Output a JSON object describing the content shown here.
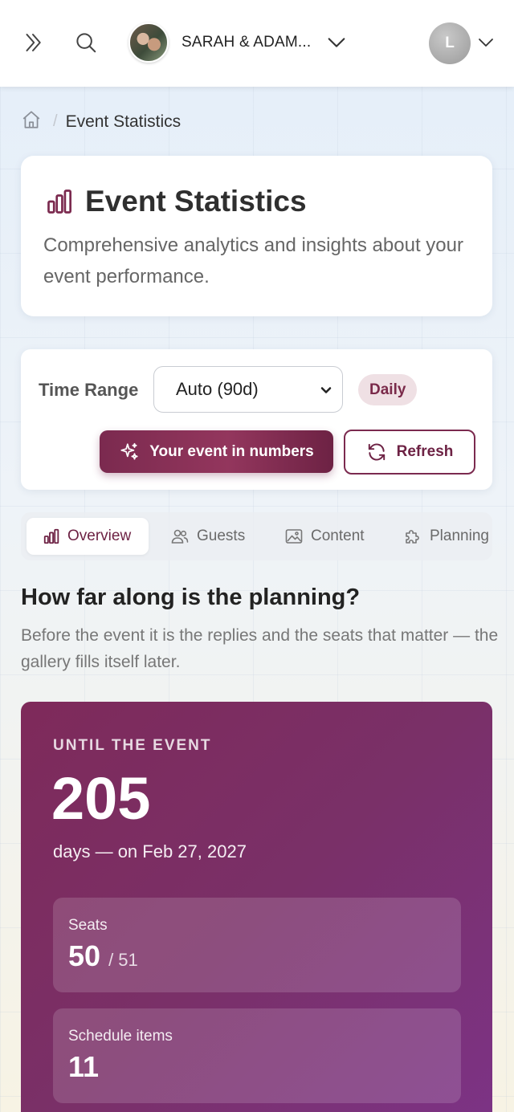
{
  "topbar": {
    "event_name": "SARAH & ADAM...",
    "user_initial": "L",
    "icons": [
      "chevrons-right-icon",
      "search-icon",
      "chevron-down-icon"
    ]
  },
  "breadcrumb": {
    "separator": "/",
    "current": "Event Statistics"
  },
  "header": {
    "title": "Event Statistics",
    "subtitle": "Comprehensive analytics and insights about your event performance."
  },
  "controls": {
    "time_range_label": "Time Range",
    "time_range_value": "Auto (90d)",
    "granularity_badge": "Daily",
    "numbers_button": "Your event in numbers",
    "refresh_button": "Refresh"
  },
  "tabs": [
    {
      "label": "Overview",
      "icon": "bar-chart-icon",
      "active": true
    },
    {
      "label": "Guests",
      "icon": "users-icon",
      "active": false
    },
    {
      "label": "Content",
      "icon": "image-icon",
      "active": false
    },
    {
      "label": "Planning",
      "icon": "puzzle-icon",
      "active": false
    }
  ],
  "section": {
    "title": "How far along is the planning?",
    "subtitle": "Before the event it is the replies and the seats that matter — the gallery fills itself later."
  },
  "hero": {
    "label": "UNTIL THE EVENT",
    "days": "205",
    "date_line": "days — on Feb 27, 2027",
    "seats": {
      "label": "Seats",
      "value": "50",
      "total": "/ 51"
    },
    "schedule": {
      "label": "Schedule items",
      "value": "11"
    }
  },
  "colors": {
    "accent": "#7b2a4f",
    "badge_bg": "#efe0e4",
    "hero_start": "#7e2a5a",
    "hero_end": "#7c3386"
  }
}
